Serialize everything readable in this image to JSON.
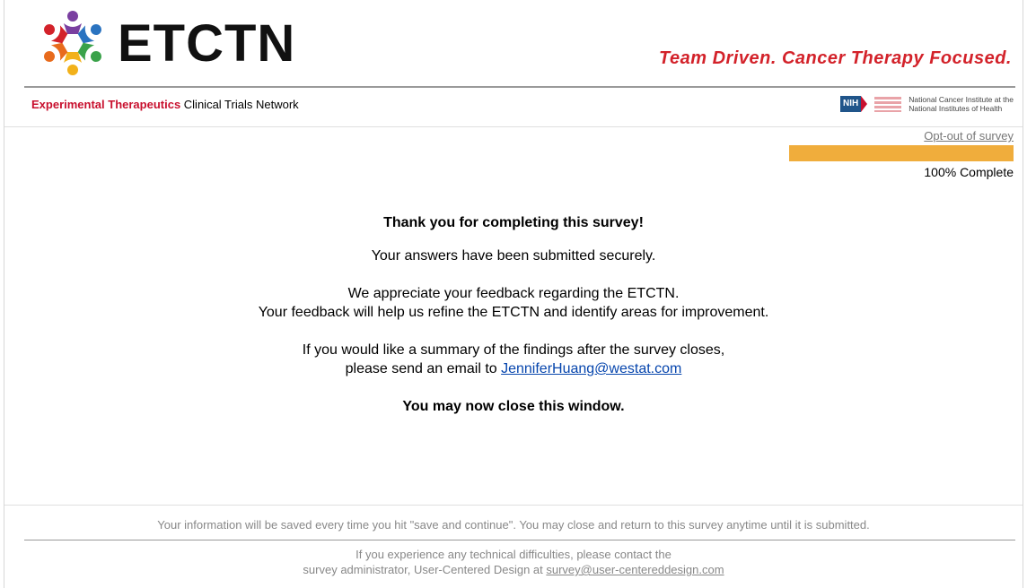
{
  "header": {
    "logo_text": "ETCTN",
    "tagline": "Team Driven. Cancer Therapy Focused.",
    "network_red": "Experimental Therapeutics",
    "network_rest": " Clinical Trials Network",
    "nih_badge": "NIH",
    "nci_line1": "National Cancer Institute at the",
    "nci_line2": "National Institutes of Health"
  },
  "progress": {
    "optout_label": "Opt-out of survey",
    "percent": 100,
    "label": "100% Complete",
    "color": "#f0ad3c"
  },
  "message": {
    "thanks": "Thank you for completing this survey!",
    "submitted": "Your answers have been submitted securely.",
    "appreciate": "We appreciate your feedback regarding the ETCTN.",
    "refine": "Your feedback will help us refine the ETCTN and identify areas for improvement.",
    "summary": "If you would like a summary of the findings after the survey closes,",
    "email_prefix": "please send an email to ",
    "email": "JenniferHuang@westat.com",
    "close": "You may now close this window."
  },
  "footer": {
    "save_note": "Your information will be saved every time you hit \"save and continue\". You may close and return to this survey anytime until it is submitted.",
    "tech_line1": "If you experience any technical difficulties, please contact the",
    "tech_line2_prefix": "survey administrator, User-Centered Design at ",
    "tech_email": "survey@user-centereddesign.com"
  },
  "colors": {
    "brand_red": "#d3222a",
    "progress_orange": "#f0ad3c",
    "link_blue": "#0645ad"
  }
}
